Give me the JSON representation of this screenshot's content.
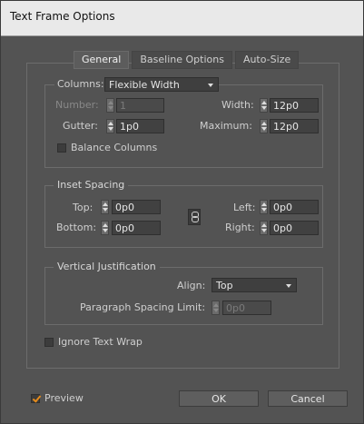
{
  "window": {
    "title": "Text Frame Options"
  },
  "tabs": [
    {
      "label": "General",
      "active": true
    },
    {
      "label": "Baseline Options",
      "active": false
    },
    {
      "label": "Auto-Size",
      "active": false
    }
  ],
  "columns": {
    "label": "Columns:",
    "type_value": "Flexible Width",
    "number_label": "Number:",
    "number_value": "1",
    "width_label": "Width:",
    "width_value": "12p0",
    "gutter_label": "Gutter:",
    "gutter_value": "1p0",
    "maximum_label": "Maximum:",
    "maximum_value": "12p0",
    "balance_label": "Balance Columns",
    "balance_checked": false
  },
  "inset": {
    "legend": "Inset Spacing",
    "top_label": "Top:",
    "top_value": "0p0",
    "bottom_label": "Bottom:",
    "bottom_value": "0p0",
    "left_label": "Left:",
    "left_value": "0p0",
    "right_label": "Right:",
    "right_value": "0p0"
  },
  "vertical": {
    "legend": "Vertical Justification",
    "align_label": "Align:",
    "align_value": "Top",
    "spacing_label": "Paragraph Spacing Limit:",
    "spacing_value": "0p0"
  },
  "ignore_wrap": {
    "label": "Ignore Text Wrap",
    "checked": false
  },
  "footer": {
    "preview_label": "Preview",
    "preview_checked": true,
    "ok_label": "OK",
    "cancel_label": "Cancel"
  },
  "colors": {
    "accent": "#e58b1b",
    "dialog_bg": "#535353",
    "titlebar_bg": "#e9e9e9"
  }
}
